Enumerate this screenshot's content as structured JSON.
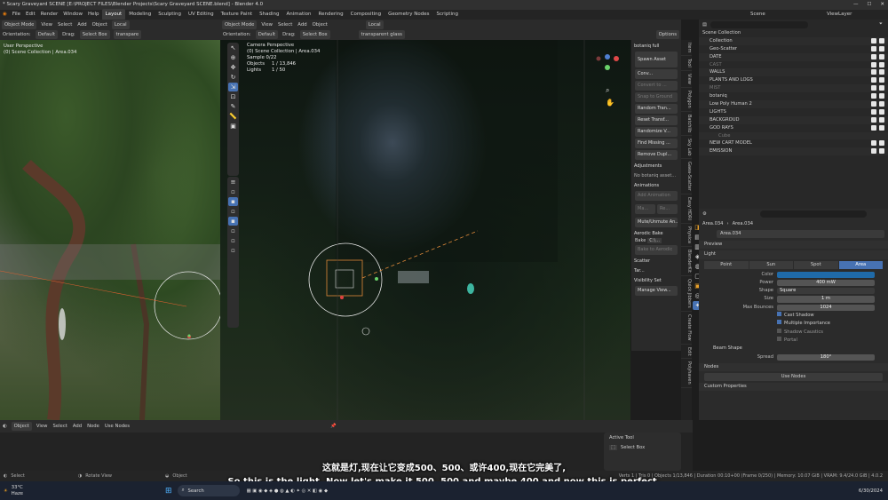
{
  "window": {
    "title": "* Scary Graveyard SCENE [E:\\PROJECT FILES\\Blender Projects\\Scary Graveyard SCENE.blend] - Blender 4.0"
  },
  "menubar": {
    "menus": [
      "File",
      "Edit",
      "Render",
      "Window",
      "Help"
    ],
    "workspaces": [
      "Layout",
      "Modeling",
      "Sculpting",
      "UV Editing",
      "Texture Paint",
      "Shading",
      "Animation",
      "Rendering",
      "Compositing",
      "Geometry Nodes",
      "Scripting"
    ],
    "scene": "Scene",
    "view_layer": "ViewLayer"
  },
  "left_viewport": {
    "header": [
      "Object Mode",
      "View",
      "Select",
      "Add",
      "Object",
      "Local"
    ],
    "header2": [
      "Orientation:",
      "Default",
      "Drag:",
      "Select Box",
      "transpare"
    ],
    "overlay_line1": "User Perspective",
    "overlay_line2": "(0) Scene Collection | Area.034"
  },
  "main_viewport": {
    "header": [
      "Object Mode",
      "View",
      "Select",
      "Add",
      "Object",
      "Local"
    ],
    "header2": [
      "Orientation:",
      "Default",
      "Drag:",
      "Select Box",
      "transparent glass"
    ],
    "options_label": "Options",
    "overlay": {
      "line1": "Camera Perspective",
      "line2": "(0) Scene Collection | Area.034",
      "line3": "Sample 0/22",
      "objects_label": "Objects",
      "objects_value": "1 / 13,846",
      "lights_label": "Lights",
      "lights_value": "1 / 50"
    }
  },
  "npanel": {
    "title": "botaniq full",
    "buttons": [
      "Spawn Asset",
      "Conv...",
      "Convert to ...",
      "Snap to Ground",
      "Random Tran...",
      "Reset Transf...",
      "Randomize V...",
      "Find Missing ...",
      "Remove Dupl..."
    ],
    "adjustments_head": "Adjustments",
    "adjustments_text": "No botaniq asset...",
    "animations_head": "Animations",
    "add_animation": "Add Animation",
    "buttons2": [
      "Ma...",
      "Re...",
      "Mute/Unmute An..."
    ],
    "aerodic_bake": "Aerodic Bake",
    "bake_label": "Bake",
    "bake_value": "C:\\...",
    "bake_button": "Bake to Aerodic",
    "scatter_head": "Scatter",
    "tar_label": "Tar...",
    "visibility_head": "Visibility Set",
    "manage_view": "Manage View..."
  },
  "vtabs": [
    "Item",
    "Tool",
    "View",
    "Polygon",
    "Batchlib",
    "Sky Lab",
    "Gaea-Scatter",
    "Easy HDRI",
    "Physica",
    "BlenderKit",
    "Quick Jibbers",
    "Create Flow",
    "Edit",
    "Polyhaven"
  ],
  "outliner": {
    "search_placeholder": "",
    "items": [
      "Scene Collection",
      "Collection",
      "Geo-Scatter",
      "DATE",
      "CAST",
      "WALLS",
      "PLANTS AND LOGS",
      "MIST",
      "botaniq",
      "Low Poly Human 2",
      "LIGHTS",
      "BACKGROUD",
      "GOD RAYS",
      "Cube",
      "NEW CART MODEL",
      "EMISSION"
    ]
  },
  "properties": {
    "breadcrumb_a": "Area.034",
    "breadcrumb_b": "Area.034",
    "name_field": "Area.034",
    "preview_head": "Preview",
    "light_head": "Light",
    "light_types": [
      "Point",
      "Sun",
      "Spot",
      "Area"
    ],
    "active_light_type": "Area",
    "color_label": "Color",
    "color_value": "#1f6aa8",
    "power_label": "Power",
    "power_value": "400 mW",
    "shape_label": "Shape",
    "shape_value": "Square",
    "size_label": "Size",
    "size_value": "1 m",
    "bounces_label": "Max Bounces",
    "bounces_value": "1024",
    "cast_shadow": "Cast Shadow",
    "multiple_importance": "Multiple Importance",
    "shadow_caustics": "Shadow Caustics",
    "portal": "Portal",
    "beam_shape_head": "Beam Shape",
    "spread_label": "Spread",
    "spread_value": "180°",
    "nodes_head": "Nodes",
    "use_nodes": "Use Nodes",
    "custom_props_head": "Custom Properties"
  },
  "timeline": {
    "header": [
      "Object",
      "View",
      "Select",
      "Add",
      "Node",
      "Use Nodes"
    ]
  },
  "active_tool": {
    "head": "Active Tool",
    "tool": "Select Box"
  },
  "statusbar": {
    "select": "Select",
    "rotate": "Rotate View",
    "object": "Object",
    "info": "Verts 1 | Tris 0 | Objects 1/13,846 | Duration 00:10+00 (Frame 0/250) | Memory: 10.07 GiB | VRAM: 9.4/24.0 GiB | 4.0.2"
  },
  "subtitles": {
    "chinese": "这就是灯,现在让它变成500、500、或许400,现在它完美了,",
    "english": "So this is the light, Now let's make it 500, 500 and maybe 400 and now this is perfect,"
  },
  "taskbar": {
    "weather_temp": "33°C",
    "weather_text": "Haze",
    "search": "Search",
    "date": "6/30/2024"
  }
}
